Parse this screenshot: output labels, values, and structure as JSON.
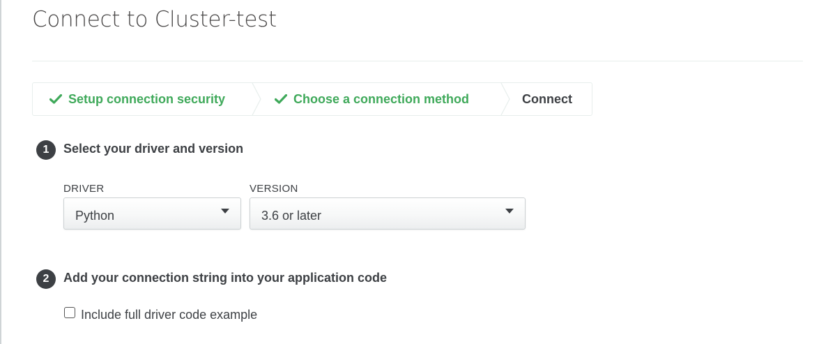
{
  "modal": {
    "title": "Connect to Cluster-test"
  },
  "stepper": {
    "steps": [
      {
        "label": "Setup connection security",
        "status": "done",
        "icon": "checkmark-icon"
      },
      {
        "label": "Choose a connection method",
        "status": "done",
        "icon": "checkmark-icon"
      },
      {
        "label": "Connect",
        "status": "current"
      }
    ],
    "separator_icon": "chevron-right-icon"
  },
  "section1": {
    "number": "1",
    "title": "Select your driver and version",
    "driver": {
      "label": "DRIVER",
      "selected": "Python",
      "icon": "caret-down-icon"
    },
    "version": {
      "label": "VERSION",
      "selected": "3.6 or later",
      "icon": "caret-down-icon"
    }
  },
  "section2": {
    "number": "2",
    "title": "Add your connection string into your application code",
    "checkbox": {
      "label": "Include full driver code example",
      "checked": false
    }
  },
  "colors": {
    "done_green": "#3fa95a",
    "dark_text": "#3d4044",
    "badge_bg": "#3d4044",
    "border": "#e7eeec"
  }
}
